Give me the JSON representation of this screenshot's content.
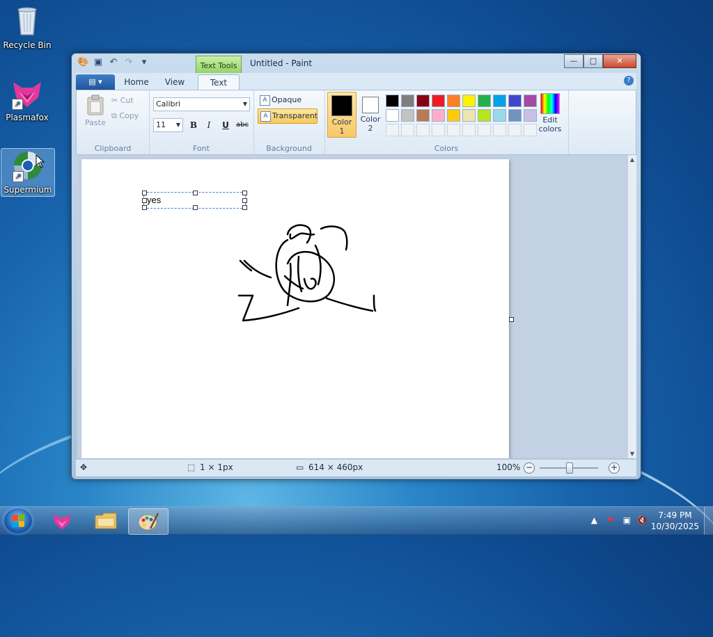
{
  "desktop": {
    "icons": [
      {
        "label": "Recycle Bin",
        "icon": "recycle-bin-icon"
      },
      {
        "label": "Plasmafox",
        "icon": "plasmafox-icon"
      },
      {
        "label": "Supermium",
        "icon": "supermium-icon"
      }
    ]
  },
  "window": {
    "title": "Untitled - Paint",
    "context_tab": "Text Tools",
    "tabs": [
      "Home",
      "View",
      "Text"
    ],
    "active_tab": "Text"
  },
  "ribbon": {
    "clipboard": {
      "paste": "Paste",
      "cut": "Cut",
      "copy": "Copy",
      "label": "Clipboard"
    },
    "font": {
      "family": "Calibri",
      "size": "11",
      "bold": "B",
      "italic": "I",
      "underline": "U",
      "strike": "abc",
      "label": "Font"
    },
    "background": {
      "opaque": "Opaque",
      "transparent": "Transparent",
      "label": "Background",
      "selected": "Transparent"
    },
    "colors": {
      "color1_label": "Color\n1",
      "color2_label": "Color\n2",
      "color1": "#000000",
      "color2": "#ffffff",
      "edit_colors": "Edit colors",
      "label": "Colors",
      "palette_row1": [
        "#000000",
        "#7f7f7f",
        "#880015",
        "#ed1c24",
        "#ff7f27",
        "#fff200",
        "#22b14c",
        "#00a2e8",
        "#3f48cc",
        "#a349a4"
      ],
      "palette_row2": [
        "#ffffff",
        "#c3c3c3",
        "#b97a57",
        "#ffaec9",
        "#ffc90e",
        "#efe4b0",
        "#b5e61d",
        "#99d9ea",
        "#7092be",
        "#c8bfe7"
      ]
    }
  },
  "canvas": {
    "text_box_value": "yes"
  },
  "status": {
    "selection_size": "1 × 1px",
    "canvas_size": "614 × 460px",
    "zoom": "100%"
  },
  "taskbar": {
    "time": "7:49 PM",
    "date": "10/30/2025"
  }
}
